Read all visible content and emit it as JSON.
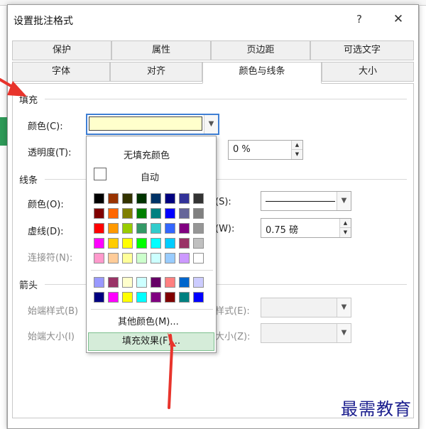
{
  "dialog": {
    "title": "设置批注格式",
    "help": "?",
    "close": "✕"
  },
  "tabs_row1": [
    "保护",
    "属性",
    "页边距",
    "可选文字"
  ],
  "tabs_row2": [
    "字体",
    "对齐",
    "颜色与线条",
    "大小"
  ],
  "active_tab": "颜色与线条",
  "fill": {
    "section": "填充",
    "color_label": "颜色(C):",
    "transparency_label": "透明度(T):",
    "transparency_value": "0 %",
    "selected_color": "#ffffcc"
  },
  "line": {
    "section": "线条",
    "color_label": "颜色(O):",
    "dash_label": "虚线(D):",
    "connector_label": "连接符(N):",
    "style_label": "(S):",
    "weight_label": "(W):",
    "weight_value": "0.75 磅"
  },
  "arrows": {
    "section": "箭头",
    "begin_style_label": "始端样式(B)",
    "begin_size_label": "始端大小(I)",
    "end_style_label": "样式(E):",
    "end_size_label": "大小(Z):"
  },
  "dropdown": {
    "no_fill": "无填充颜色",
    "auto": "自动",
    "more_colors": "其他颜色(M)...",
    "fill_effects": "填充效果(F)...",
    "palette": [
      [
        "#000000",
        "#993300",
        "#333300",
        "#003300",
        "#003366",
        "#000080",
        "#333399",
        "#333333"
      ],
      [
        "#800000",
        "#ff6600",
        "#808000",
        "#008000",
        "#008080",
        "#0000ff",
        "#666699",
        "#808080"
      ],
      [
        "#ff0000",
        "#ff9900",
        "#99cc00",
        "#339966",
        "#33cccc",
        "#3366ff",
        "#800080",
        "#969696"
      ],
      [
        "#ff00ff",
        "#ffcc00",
        "#ffff00",
        "#00ff00",
        "#00ffff",
        "#00ccff",
        "#993366",
        "#c0c0c0"
      ],
      [
        "#ff99cc",
        "#ffcc99",
        "#ffff99",
        "#ccffcc",
        "#ccffff",
        "#99ccff",
        "#cc99ff",
        "#ffffff"
      ]
    ],
    "palette_extra": [
      [
        "#9999ff",
        "#993366",
        "#ffffcc",
        "#ccffff",
        "#660066",
        "#ff8080",
        "#0066cc",
        "#ccccff"
      ],
      [
        "#000080",
        "#ff00ff",
        "#ffff00",
        "#00ffff",
        "#800080",
        "#800000",
        "#008080",
        "#0000ff"
      ]
    ]
  },
  "watermark": "最需教育",
  "colors": {
    "accent_border": "#3f7fd4",
    "annotation_red": "#e8342c",
    "fill_effects_highlight": "#d5ecd9"
  }
}
